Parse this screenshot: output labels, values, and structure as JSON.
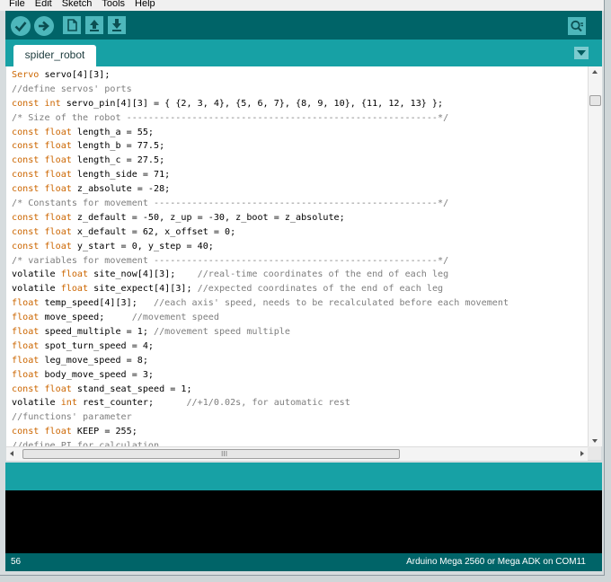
{
  "menu": [
    "File",
    "Edit",
    "Sketch",
    "Tools",
    "Help"
  ],
  "toolbar": {
    "verify_icon": "check-icon",
    "upload_icon": "arrow-right-icon",
    "new_icon": "new-file-icon",
    "open_icon": "open-arrow-up-icon",
    "save_icon": "save-arrow-down-icon",
    "serial_icon": "serial-monitor-icon"
  },
  "tab": {
    "label": "spider_robot"
  },
  "code_lines": [
    [
      {
        "t": "Servo",
        "c": "kw"
      },
      {
        "t": " servo[4][3];"
      }
    ],
    [
      {
        "t": "//define servos' ports",
        "c": "cm"
      }
    ],
    [
      {
        "t": "const",
        "c": "kw"
      },
      {
        "t": " "
      },
      {
        "t": "int",
        "c": "kw"
      },
      {
        "t": " servo_pin[4][3] = { {2, 3, 4}, {5, 6, 7}, {8, 9, 10}, {11, 12, 13} };"
      }
    ],
    [
      {
        "t": "/* Size of the robot ---------------------------------------------------------*/",
        "c": "cm"
      }
    ],
    [
      {
        "t": "const",
        "c": "kw"
      },
      {
        "t": " "
      },
      {
        "t": "float",
        "c": "kw"
      },
      {
        "t": " length_a = 55;"
      }
    ],
    [
      {
        "t": "const",
        "c": "kw"
      },
      {
        "t": " "
      },
      {
        "t": "float",
        "c": "kw"
      },
      {
        "t": " length_b = 77.5;"
      }
    ],
    [
      {
        "t": "const",
        "c": "kw"
      },
      {
        "t": " "
      },
      {
        "t": "float",
        "c": "kw"
      },
      {
        "t": " length_c = 27.5;"
      }
    ],
    [
      {
        "t": "const",
        "c": "kw"
      },
      {
        "t": " "
      },
      {
        "t": "float",
        "c": "kw"
      },
      {
        "t": " length_side = 71;"
      }
    ],
    [
      {
        "t": "const",
        "c": "kw"
      },
      {
        "t": " "
      },
      {
        "t": "float",
        "c": "kw"
      },
      {
        "t": " z_absolute = -28;"
      }
    ],
    [
      {
        "t": "/* Constants for movement ----------------------------------------------------*/",
        "c": "cm"
      }
    ],
    [
      {
        "t": "const",
        "c": "kw"
      },
      {
        "t": " "
      },
      {
        "t": "float",
        "c": "kw"
      },
      {
        "t": " z_default = -50, z_up = -30, z_boot = z_absolute;"
      }
    ],
    [
      {
        "t": "const",
        "c": "kw"
      },
      {
        "t": " "
      },
      {
        "t": "float",
        "c": "kw"
      },
      {
        "t": " x_default = 62, x_offset = 0;"
      }
    ],
    [
      {
        "t": "const",
        "c": "kw"
      },
      {
        "t": " "
      },
      {
        "t": "float",
        "c": "kw"
      },
      {
        "t": " y_start = 0, y_step = 40;"
      }
    ],
    [
      {
        "t": "/* variables for movement ----------------------------------------------------*/",
        "c": "cm"
      }
    ],
    [
      {
        "t": "volatile "
      },
      {
        "t": "float",
        "c": "kw"
      },
      {
        "t": " site_now[4][3];    "
      },
      {
        "t": "//real-time coordinates of the end of each leg",
        "c": "cm"
      }
    ],
    [
      {
        "t": "volatile "
      },
      {
        "t": "float",
        "c": "kw"
      },
      {
        "t": " site_expect[4][3]; "
      },
      {
        "t": "//expected coordinates of the end of each leg",
        "c": "cm"
      }
    ],
    [
      {
        "t": "float",
        "c": "kw"
      },
      {
        "t": " temp_speed[4][3];   "
      },
      {
        "t": "//each axis' speed, needs to be recalculated before each movement",
        "c": "cm"
      }
    ],
    [
      {
        "t": "float",
        "c": "kw"
      },
      {
        "t": " move_speed;     "
      },
      {
        "t": "//movement speed",
        "c": "cm"
      }
    ],
    [
      {
        "t": "float",
        "c": "kw"
      },
      {
        "t": " speed_multiple = 1; "
      },
      {
        "t": "//movement speed multiple",
        "c": "cm"
      }
    ],
    [
      {
        "t": "float",
        "c": "kw"
      },
      {
        "t": " spot_turn_speed = 4;"
      }
    ],
    [
      {
        "t": "float",
        "c": "kw"
      },
      {
        "t": " leg_move_speed = 8;"
      }
    ],
    [
      {
        "t": "float",
        "c": "kw"
      },
      {
        "t": " body_move_speed = 3;"
      }
    ],
    [
      {
        "t": "const",
        "c": "kw"
      },
      {
        "t": " "
      },
      {
        "t": "float",
        "c": "kw"
      },
      {
        "t": " stand_seat_speed = 1;"
      }
    ],
    [
      {
        "t": "volatile "
      },
      {
        "t": "int",
        "c": "kw"
      },
      {
        "t": " rest_counter;      "
      },
      {
        "t": "//+1/0.02s, for automatic rest",
        "c": "cm"
      }
    ],
    [
      {
        "t": "//functions' parameter",
        "c": "cm"
      }
    ],
    [
      {
        "t": "const",
        "c": "kw"
      },
      {
        "t": " "
      },
      {
        "t": "float",
        "c": "kw"
      },
      {
        "t": " KEEP = 255;"
      }
    ],
    [
      {
        "t": "//define PI for calculation",
        "c": "cm"
      }
    ]
  ],
  "hscroll": {
    "grip": "III"
  },
  "footer": {
    "line_number": "56",
    "board": "Arduino Mega 2560 or Mega ADK on COM11"
  }
}
